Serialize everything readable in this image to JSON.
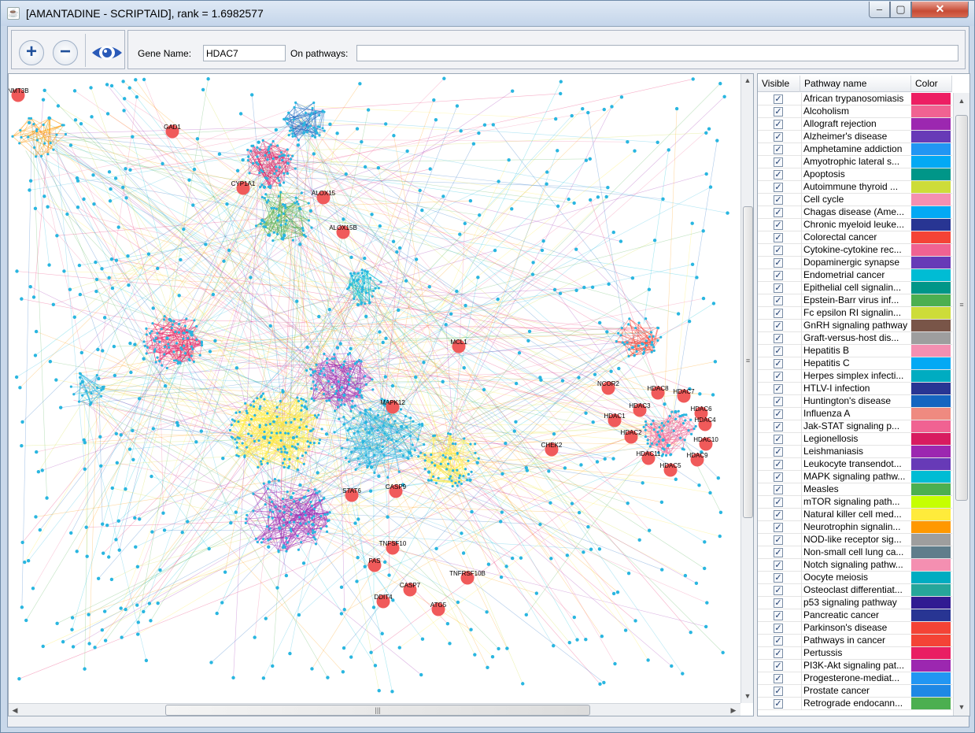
{
  "window": {
    "title": "[AMANTADINE - SCRIPTAID], rank = 1.6982577",
    "app_icon": "java-icon",
    "controls": {
      "minimize": "–",
      "maximize": "▢",
      "close": "✕"
    }
  },
  "toolbar": {
    "zoom_in_icon": "plus-icon",
    "zoom_out_icon": "minus-icon",
    "view_icon": "eye-icon",
    "zoom_in_label": "+",
    "zoom_out_label": "−",
    "gene_name_label": "Gene Name:",
    "gene_name_value": "HDAC7",
    "on_pathways_label": "On pathways:",
    "on_pathways_value": ""
  },
  "graph": {
    "node_color": "#f05a5a",
    "small_node_color": "#29b6e0",
    "labeled_nodes": [
      "NMT3B",
      "GAD1",
      "CYP1A1",
      "ALOX15",
      "ALOX15B",
      "MCL1",
      "NCOR2",
      "HDAC8",
      "HDAC7",
      "HDAC3",
      "HDAC6",
      "HDAC1",
      "HDAC4",
      "HDAC2",
      "HDAC10",
      "HDAC11",
      "HDAC9",
      "HDAC5",
      "MAPK12",
      "CHEK2",
      "STAT6",
      "CASP9",
      "TNFSF10",
      "FAS",
      "TNFRSF10B",
      "CASP7",
      "DDIT4",
      "ATG5"
    ],
    "scrollbar_grip": "≡",
    "hscroll_grip": "|||"
  },
  "table": {
    "headers": {
      "visible": "Visible",
      "pathway": "Pathway name",
      "color": "Color"
    },
    "check_glyph": "✓",
    "rows": [
      {
        "name": "African trypanosomiasis",
        "color": "#ed1e63"
      },
      {
        "name": "Alcoholism",
        "color": "#f06292"
      },
      {
        "name": "Allograft rejection",
        "color": "#9c27b0"
      },
      {
        "name": "Alzheimer's disease",
        "color": "#673ab7"
      },
      {
        "name": "Amphetamine addiction",
        "color": "#2196f3"
      },
      {
        "name": "Amyotrophic lateral s...",
        "color": "#03a9f4"
      },
      {
        "name": "Apoptosis",
        "color": "#009688"
      },
      {
        "name": "Autoimmune thyroid ...",
        "color": "#cddc39"
      },
      {
        "name": "Cell cycle",
        "color": "#f48fb1"
      },
      {
        "name": "Chagas disease (Ame...",
        "color": "#03a9f4"
      },
      {
        "name": "Chronic myeloid leuke...",
        "color": "#283593"
      },
      {
        "name": "Colorectal cancer",
        "color": "#f44336"
      },
      {
        "name": "Cytokine-cytokine rec...",
        "color": "#f06292"
      },
      {
        "name": "Dopaminergic synapse",
        "color": "#673ab7"
      },
      {
        "name": "Endometrial cancer",
        "color": "#00bcd4"
      },
      {
        "name": "Epithelial cell signalin...",
        "color": "#009688"
      },
      {
        "name": "Epstein-Barr virus inf...",
        "color": "#4caf50"
      },
      {
        "name": "Fc epsilon RI signalin...",
        "color": "#cddc39"
      },
      {
        "name": "GnRH signaling pathway",
        "color": "#795548"
      },
      {
        "name": "Graft-versus-host dis...",
        "color": "#9e9e9e"
      },
      {
        "name": "Hepatitis B",
        "color": "#f48fb1"
      },
      {
        "name": "Hepatitis C",
        "color": "#03a9f4"
      },
      {
        "name": "Herpes simplex infecti...",
        "color": "#00acc1"
      },
      {
        "name": "HTLV-I infection",
        "color": "#283593"
      },
      {
        "name": "Huntington's disease",
        "color": "#1565c0"
      },
      {
        "name": "Influenza A",
        "color": "#ef8a80"
      },
      {
        "name": "Jak-STAT signaling p...",
        "color": "#f06292"
      },
      {
        "name": "Legionellosis",
        "color": "#d81b60"
      },
      {
        "name": "Leishmaniasis",
        "color": "#9c27b0"
      },
      {
        "name": "Leukocyte transendot...",
        "color": "#673ab7"
      },
      {
        "name": "MAPK signaling pathw...",
        "color": "#00bcd4"
      },
      {
        "name": "Measles",
        "color": "#4caf50"
      },
      {
        "name": "mTOR signaling path...",
        "color": "#c6ff00"
      },
      {
        "name": "Natural killer cell med...",
        "color": "#ffeb3b"
      },
      {
        "name": "Neurotrophin signalin...",
        "color": "#ff9800"
      },
      {
        "name": "NOD-like receptor sig...",
        "color": "#9e9e9e"
      },
      {
        "name": "Non-small cell lung ca...",
        "color": "#607d8b"
      },
      {
        "name": "Notch signaling pathw...",
        "color": "#f48fb1"
      },
      {
        "name": "Oocyte meiosis",
        "color": "#00acc1"
      },
      {
        "name": "Osteoclast differentiat...",
        "color": "#26a69a"
      },
      {
        "name": "p53 signaling pathway",
        "color": "#311b92"
      },
      {
        "name": "Pancreatic cancer",
        "color": "#283593"
      },
      {
        "name": "Parkinson's disease",
        "color": "#f44336"
      },
      {
        "name": "Pathways in cancer",
        "color": "#f44336"
      },
      {
        "name": "Pertussis",
        "color": "#e91e63"
      },
      {
        "name": "PI3K-Akt signaling pat...",
        "color": "#9c27b0"
      },
      {
        "name": "Progesterone-mediat...",
        "color": "#2196f3"
      },
      {
        "name": "Prostate cancer",
        "color": "#1e88e5"
      },
      {
        "name": "Retrograde endocann...",
        "color": "#4caf50"
      }
    ]
  }
}
